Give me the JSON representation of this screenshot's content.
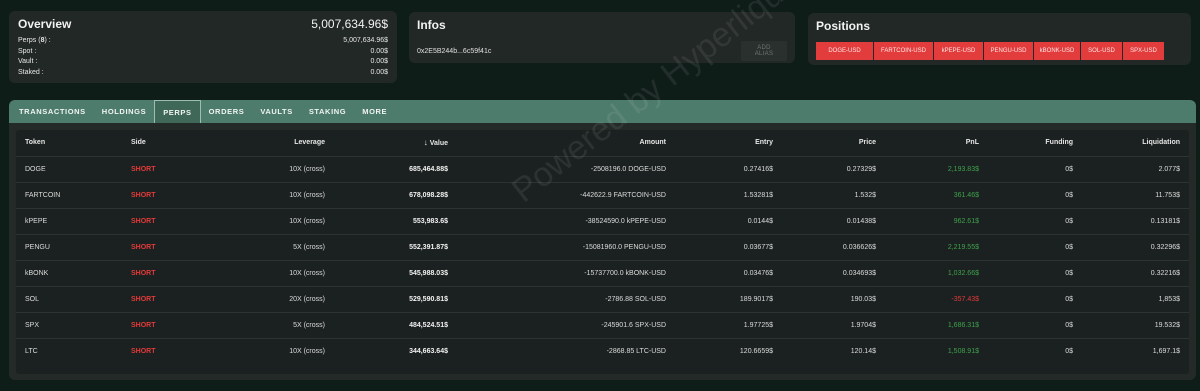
{
  "overview": {
    "title": "Overview",
    "total": "5,007,634.96$",
    "rows": [
      {
        "label": "Perps",
        "count": "8",
        "suffix": ") :",
        "value": "5,007,634.96$"
      },
      {
        "label": "Spot :",
        "value": "0.00$"
      },
      {
        "label": "Vault :",
        "value": "0.00$"
      },
      {
        "label": "Staked :",
        "value": "0.00$"
      }
    ]
  },
  "infos": {
    "title": "Infos",
    "address": "0x2E5B244b...6c59f41c",
    "add_alias_label": "ADD ALIAS"
  },
  "positions": {
    "title": "Positions",
    "chips": [
      "DOGE-USD",
      "FARTCOIN-USD",
      "kPEPE-USD",
      "PENGU-USD",
      "kBONK-USD",
      "SOL-USD",
      "SPX-USD"
    ]
  },
  "tabs": [
    "TRANSACTIONS",
    "HOLDINGS",
    "PERPS",
    "ORDERS",
    "VAULTS",
    "STAKING",
    "MORE"
  ],
  "active_tab": "PERPS",
  "table": {
    "headers": [
      "Token",
      "Side",
      "Leverage",
      "Value",
      "Amount",
      "Entry",
      "Price",
      "PnL",
      "Funding",
      "Liquidation"
    ],
    "sort_arrow": "↓",
    "rows": [
      {
        "token": "DOGE",
        "side": "SHORT",
        "leverage": "10X (cross)",
        "value": "685,464.88$",
        "amount": "-2508196.0 DOGE-USD",
        "entry": "0.27416$",
        "price": "0.27329$",
        "pnl": "2,193.83$",
        "pnl_sign": "pos",
        "funding": "0$",
        "liquidation": "2.077$"
      },
      {
        "token": "FARTCOIN",
        "side": "SHORT",
        "leverage": "10X (cross)",
        "value": "678,098.28$",
        "amount": "-442622.9 FARTCOIN-USD",
        "entry": "1.53281$",
        "price": "1.532$",
        "pnl": "361.46$",
        "pnl_sign": "pos",
        "funding": "0$",
        "liquidation": "11.753$"
      },
      {
        "token": "kPEPE",
        "side": "SHORT",
        "leverage": "10X (cross)",
        "value": "553,983.6$",
        "amount": "-38524590.0 kPEPE-USD",
        "entry": "0.0144$",
        "price": "0.01438$",
        "pnl": "962.61$",
        "pnl_sign": "pos",
        "funding": "0$",
        "liquidation": "0.13181$"
      },
      {
        "token": "PENGU",
        "side": "SHORT",
        "leverage": "5X (cross)",
        "value": "552,391.87$",
        "amount": "-15081960.0 PENGU-USD",
        "entry": "0.03677$",
        "price": "0.036626$",
        "pnl": "2,219.55$",
        "pnl_sign": "pos",
        "funding": "0$",
        "liquidation": "0.32296$"
      },
      {
        "token": "kBONK",
        "side": "SHORT",
        "leverage": "10X (cross)",
        "value": "545,988.03$",
        "amount": "-15737700.0 kBONK-USD",
        "entry": "0.03476$",
        "price": "0.034693$",
        "pnl": "1,032.66$",
        "pnl_sign": "pos",
        "funding": "0$",
        "liquidation": "0.32216$"
      },
      {
        "token": "SOL",
        "side": "SHORT",
        "leverage": "20X (cross)",
        "value": "529,590.81$",
        "amount": "-2786.88 SOL-USD",
        "entry": "189.9017$",
        "price": "190.03$",
        "pnl": "-357.43$",
        "pnl_sign": "neg",
        "funding": "0$",
        "liquidation": "1,853$"
      },
      {
        "token": "SPX",
        "side": "SHORT",
        "leverage": "5X (cross)",
        "value": "484,524.51$",
        "amount": "-245901.6 SPX-USD",
        "entry": "1.97725$",
        "price": "1.9704$",
        "pnl": "1,686.31$",
        "pnl_sign": "pos",
        "funding": "0$",
        "liquidation": "19.532$"
      },
      {
        "token": "LTC",
        "side": "SHORT",
        "leverage": "10X (cross)",
        "value": "344,663.64$",
        "amount": "-2868.85 LTC-USD",
        "entry": "120.6659$",
        "price": "120.14$",
        "pnl": "1,508.91$",
        "pnl_sign": "pos",
        "funding": "0$",
        "liquidation": "1,697.1$"
      }
    ]
  },
  "watermark": "Powered by Hyperliquid",
  "colors": {
    "short": "#e23a3a",
    "pnl_positive": "#3fa14d",
    "tab_bar": "#4e7c6c",
    "position_chip": "#e23c3c"
  }
}
